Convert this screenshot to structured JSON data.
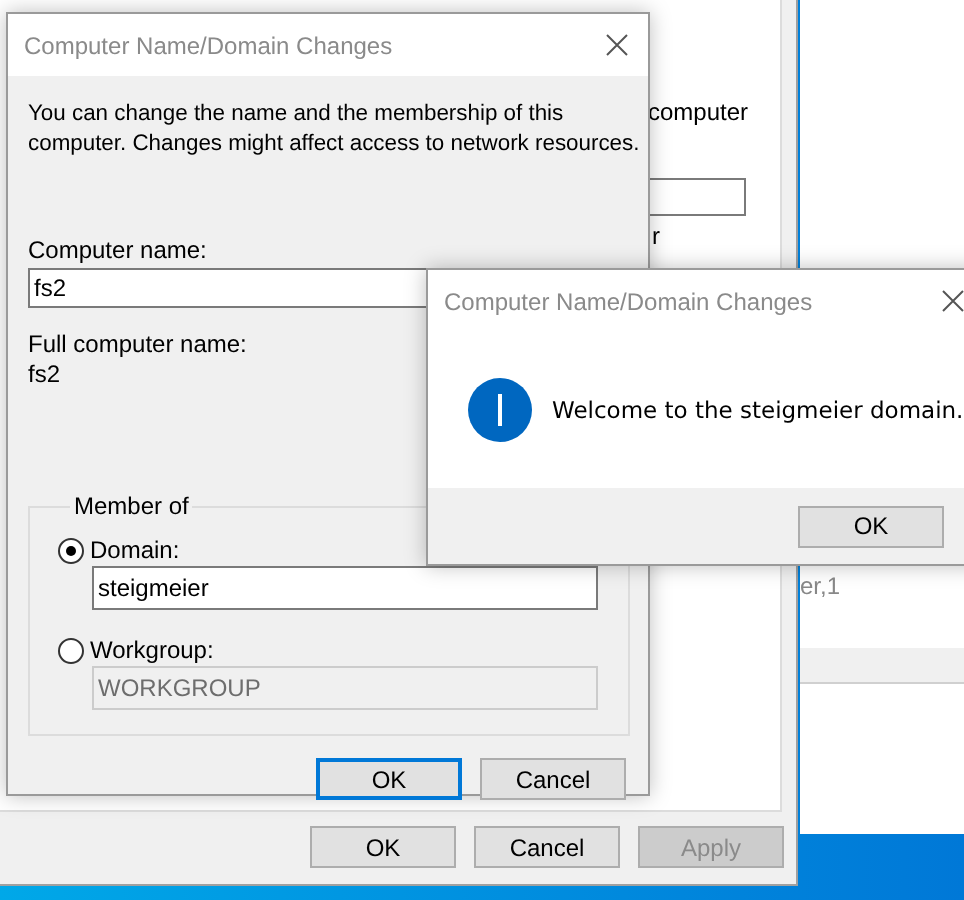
{
  "background_window": {
    "fragments": [
      "computer",
      "r"
    ],
    "buttons": [
      {
        "label": "OK",
        "disabled": false
      },
      {
        "label": "Cancel",
        "disabled": false
      },
      {
        "label": "Apply",
        "disabled": true
      }
    ]
  },
  "right_window": {
    "fragment": "er,1"
  },
  "dialog": {
    "title": "Computer Name/Domain Changes",
    "description": "You can change the name and the membership of this computer. Changes might affect access to network resources.",
    "computer_name_label": "Computer name:",
    "computer_name": "fs2",
    "full_name_label": "Full computer name:",
    "full_name": "fs2",
    "member_of": {
      "legend": "Member of",
      "options": [
        {
          "label": "Domain:",
          "selected": true,
          "value": "steigmeier",
          "disabled": false
        },
        {
          "label": "Workgroup:",
          "selected": false,
          "value": "WORKGROUP",
          "disabled": true
        }
      ]
    },
    "buttons": [
      {
        "label": "OK",
        "focused": true
      },
      {
        "label": "Cancel",
        "focused": false
      }
    ]
  },
  "message_box": {
    "title": "Computer Name/Domain Changes",
    "message": "Welcome to the steigmeier domain.",
    "button": "OK"
  }
}
